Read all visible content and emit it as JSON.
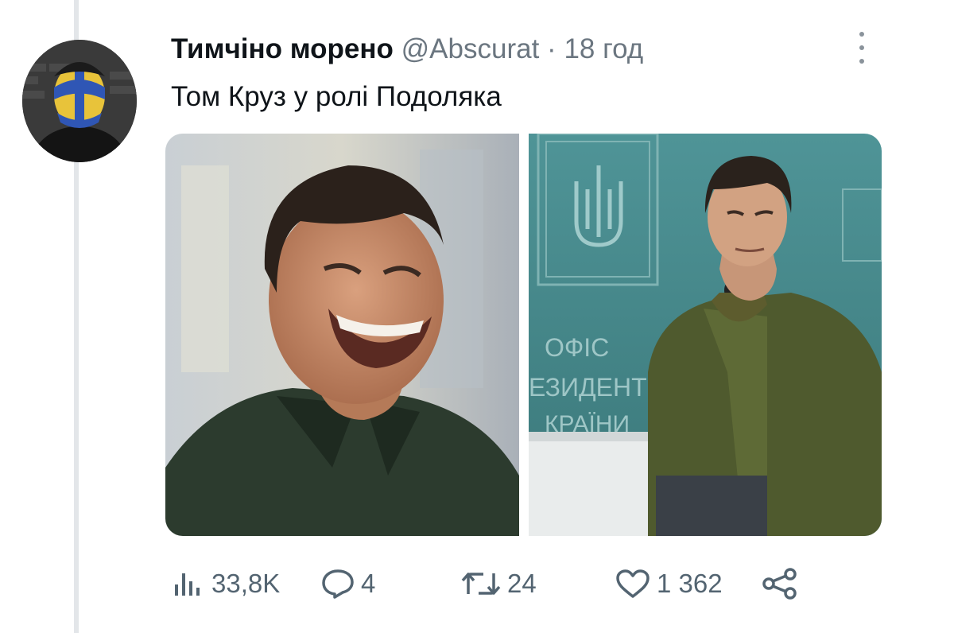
{
  "tweet": {
    "author_name": "Тимчіно морено",
    "handle": "@Abscurat",
    "separator": "·",
    "time": "18 год",
    "text": "Том Круз у ролі Подоляка"
  },
  "media": [
    {
      "photo_description": "tom-cruise-smiling"
    },
    {
      "photo_description": "podolyak-at-podium",
      "backdrop_text": [
        "ОФІС",
        "ЕЗИДЕНТ",
        "КРАЇНИ"
      ]
    }
  ],
  "stats": {
    "views": "33,8K",
    "replies": "4",
    "retweets": "24",
    "likes": "1 362"
  },
  "colors": {
    "text": "#0f1419",
    "muted": "#536471",
    "thread_line": "#e3e6e9",
    "jacket_green": "#4f5a2e",
    "backdrop_teal": "#3e8486"
  }
}
